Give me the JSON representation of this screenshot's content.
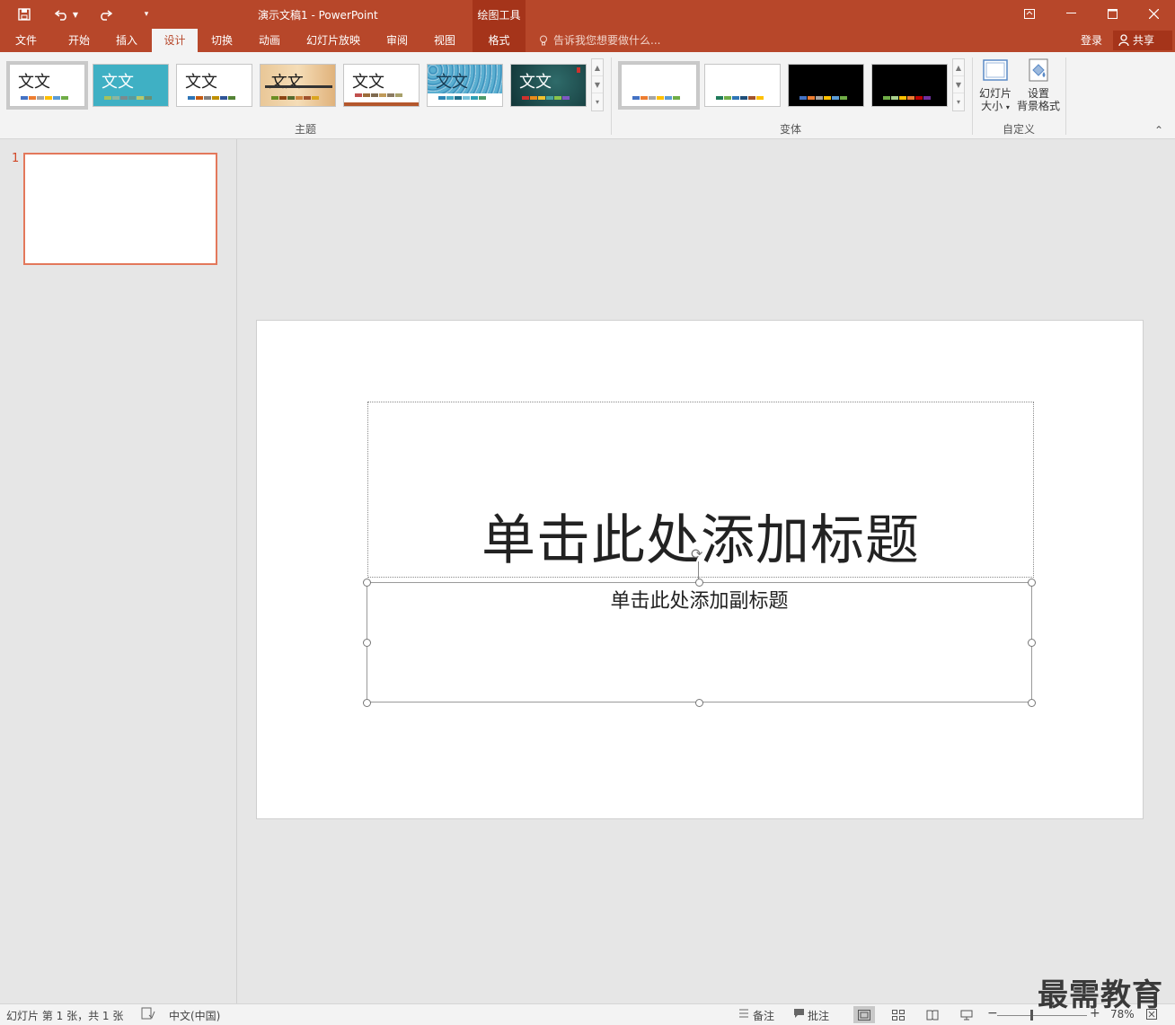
{
  "window": {
    "title": "演示文稿1 - PowerPoint",
    "context_tools": "绘图工具"
  },
  "tabs": [
    {
      "label": "文件"
    },
    {
      "label": "开始"
    },
    {
      "label": "插入"
    },
    {
      "label": "设计"
    },
    {
      "label": "切换"
    },
    {
      "label": "动画"
    },
    {
      "label": "幻灯片放映"
    },
    {
      "label": "审阅"
    },
    {
      "label": "视图"
    },
    {
      "label": "格式"
    }
  ],
  "active_tab": "设计",
  "tell_me": "告诉我您想要做什么...",
  "account": {
    "login": "登录",
    "share": "共享"
  },
  "ribbon": {
    "themes_label": "主题",
    "variants_label": "变体",
    "customize_label": "自定义",
    "theme_sample_text": "文文",
    "slide_size": {
      "line1": "幻灯片",
      "line2": "大小"
    },
    "format_bg": {
      "line1": "设置",
      "line2": "背景格式"
    }
  },
  "colors": {
    "brand": "#b7472a",
    "brand_dark": "#a5341a",
    "thumb_border": "#e3785b"
  },
  "thumbnails": [
    {
      "number": "1"
    }
  ],
  "slide": {
    "title_placeholder": "单击此处添加标题",
    "subtitle_placeholder": "单击此处添加副标题"
  },
  "status": {
    "slide_info": "幻灯片 第 1 张，共 1 张",
    "language": "中文(中国)",
    "notes": "备注",
    "comments": "批注",
    "zoom": "78%"
  },
  "watermark": "最需教育"
}
